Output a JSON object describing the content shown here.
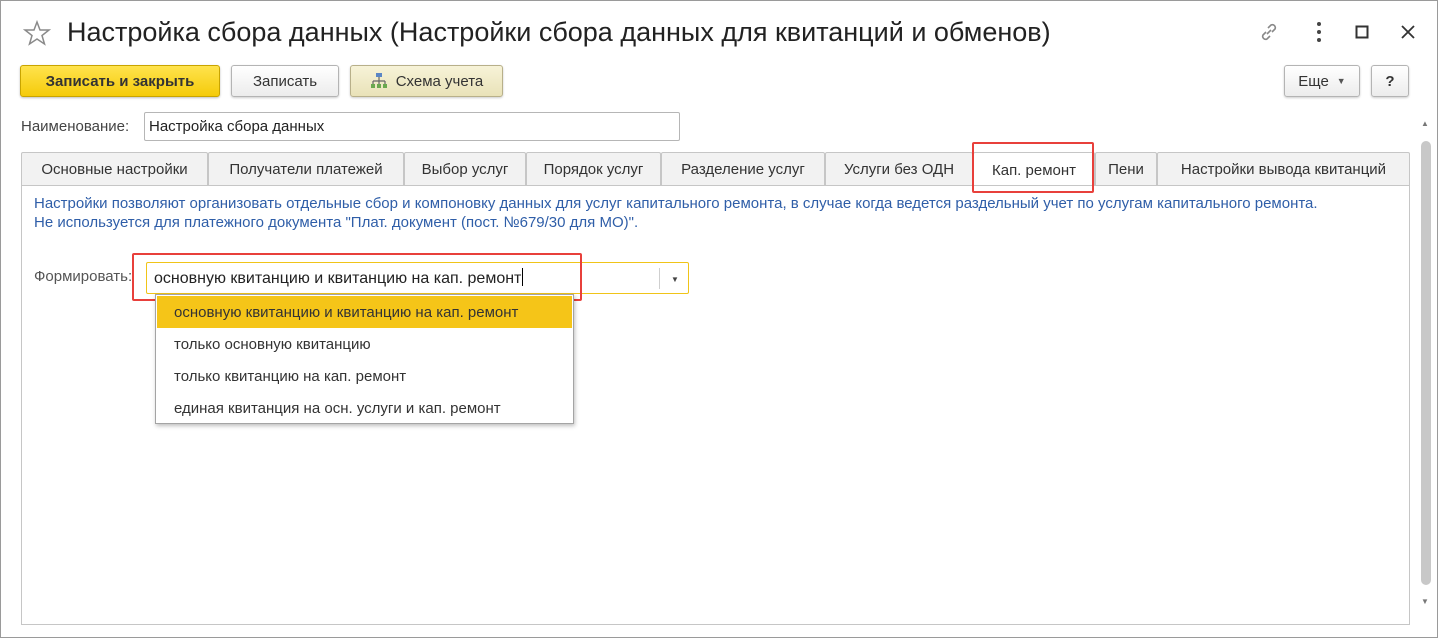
{
  "window": {
    "title": "Настройка сбора данных (Настройки сбора данных для квитанций и обменов)"
  },
  "toolbar": {
    "save_close_label": "Записать и закрыть",
    "save_label": "Записать",
    "scheme_label": "Схема учета",
    "more_label": "Еще",
    "help_label": "?"
  },
  "name_field": {
    "label": "Наименование:",
    "value": "Настройка сбора данных"
  },
  "tabs": [
    {
      "label": "Основные настройки"
    },
    {
      "label": "Получатели платежей"
    },
    {
      "label": "Выбор услуг"
    },
    {
      "label": "Порядок услуг"
    },
    {
      "label": "Разделение услуг"
    },
    {
      "label": "Услуги без ОДН"
    },
    {
      "label": "Кап. ремонт"
    },
    {
      "label": "Пени"
    },
    {
      "label": "Настройки вывода квитанций"
    }
  ],
  "active_tab": "Кап. ремонт",
  "info": {
    "line1": "Настройки позволяют организовать отдельные сбор и компоновку данных для услуг капитального ремонта, в случае когда ведется раздельный учет по услугам капитального ремонта.",
    "line2": "Не используется для платежного документа \"Плат. документ (пост. №679/30 для МО)\"."
  },
  "form": {
    "label": "Формировать:",
    "value": "основную квитанцию и квитанцию на кап. ремонт",
    "options": [
      "основную квитанцию и квитанцию на кап. ремонт",
      "только основную квитанцию",
      "только квитанцию на кап. ремонт",
      "единая квитанция на осн. услуги и кап. ремонт"
    ],
    "selected_index": 0
  },
  "colors": {
    "accent_yellow": "#f5c518",
    "highlight_red": "#e8403b",
    "info_blue": "#2f5ea8"
  },
  "icons": {
    "favorite": "star-icon",
    "link": "link-icon",
    "menu": "more-dots-icon",
    "maximize": "maximize-icon",
    "close": "close-icon",
    "scheme": "hierarchy-icon"
  }
}
